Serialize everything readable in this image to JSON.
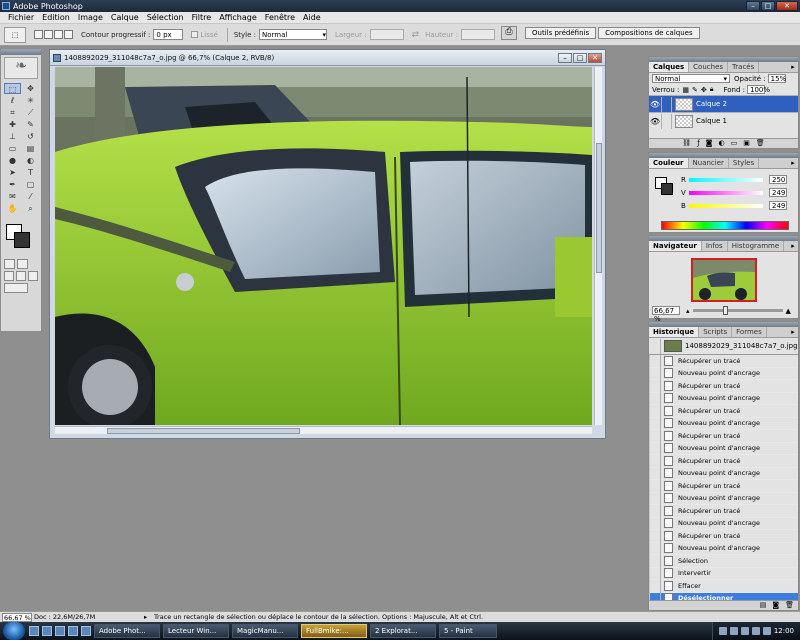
{
  "app": {
    "title": "Adobe Photoshop"
  },
  "menubar": [
    "Fichier",
    "Edition",
    "Image",
    "Calque",
    "Sélection",
    "Filtre",
    "Affichage",
    "Fenêtre",
    "Aide"
  ],
  "options": {
    "contour_label": "Contour progressif :",
    "contour_value": "0 px",
    "lisse_label": "Lissé",
    "style_label": "Style :",
    "style_value": "Normal",
    "largeur_label": "Largeur :",
    "hauteur_label": "Hauteur :",
    "tab_presets": "Outils prédéfinis",
    "tab_comps": "Compositions de calques"
  },
  "document": {
    "title": "1408892029_311048c7a7_o.jpg @ 66,7% (Calque 2, RVB/8)"
  },
  "layers": {
    "tabs": [
      "Calques",
      "Couches",
      "Tracés"
    ],
    "blend_mode": "Normal",
    "opacity_label": "Opacité :",
    "opacity": "15%",
    "lock_label": "Verrou :",
    "fill_label": "Fond :",
    "fill": "100%",
    "items": [
      {
        "name": "Calque 2",
        "selected": true
      },
      {
        "name": "Calque 1",
        "selected": false
      }
    ]
  },
  "color": {
    "tabs": [
      "Couleur",
      "Nuancier",
      "Styles"
    ],
    "channels": [
      {
        "label": "R",
        "value": "250",
        "color": "#ff0000"
      },
      {
        "label": "V",
        "value": "249",
        "color": "#c000c0"
      },
      {
        "label": "B",
        "value": "249",
        "color": "#e0d000"
      }
    ]
  },
  "navigator": {
    "tabs": [
      "Navigateur",
      "Infos",
      "Histogramme"
    ],
    "zoom": "66,67 %"
  },
  "history": {
    "tabs": [
      "Historique",
      "Scripts",
      "Formes"
    ],
    "snapshot": "1408892029_311048c7a7_o.jpg",
    "items": [
      "Récupérer un tracé",
      "Nouveau point d'ancrage",
      "Récupérer un tracé",
      "Nouveau point d'ancrage",
      "Récupérer un tracé",
      "Nouveau point d'ancrage",
      "Récupérer un tracé",
      "Nouveau point d'ancrage",
      "Récupérer un tracé",
      "Nouveau point d'ancrage",
      "Récupérer un tracé",
      "Nouveau point d'ancrage",
      "Récupérer un tracé",
      "Nouveau point d'ancrage",
      "Récupérer un tracé",
      "Nouveau point d'ancrage",
      "Sélection",
      "Intervertir",
      "Effacer",
      "Désélectionner"
    ],
    "selected_index": 19
  },
  "status": {
    "zoom": "66,67 %",
    "doc": "Doc : 22,6M/26,7M",
    "message": "Trace un rectangle de sélection ou déplace le contour de la sélection. Options : Majuscule, Alt et Ctrl."
  },
  "taskbar": {
    "tasks": [
      "Adobe Phot...",
      "Lecteur Win...",
      "MagicManu...",
      "FullBmike:...",
      "2 Explorat...",
      "5 - Paint"
    ],
    "active_index": 3,
    "clock": "12:00"
  }
}
